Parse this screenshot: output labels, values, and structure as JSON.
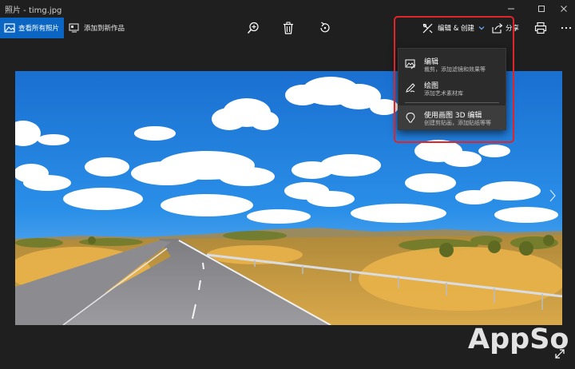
{
  "window": {
    "title": "照片 - timg.jpg"
  },
  "toolbar": {
    "view_all_label": "查看所有照片",
    "add_new_label": "添加到新作品",
    "edit_create_label": "编辑 & 创建",
    "share_label": "分享"
  },
  "dropdown": {
    "items": [
      {
        "label": "编辑",
        "description": "裁剪，添加滤镜和效果等"
      },
      {
        "label": "绘图",
        "description": "添加艺术素材库"
      },
      {
        "label": "使用画图 3D 编辑",
        "description": "创建剪贴画，添加贴纸等等"
      }
    ]
  },
  "watermark": "AppSo",
  "colors": {
    "accent": "#0a66c2",
    "highlight_box": "#e0242a",
    "background": "#1f1f1f"
  }
}
